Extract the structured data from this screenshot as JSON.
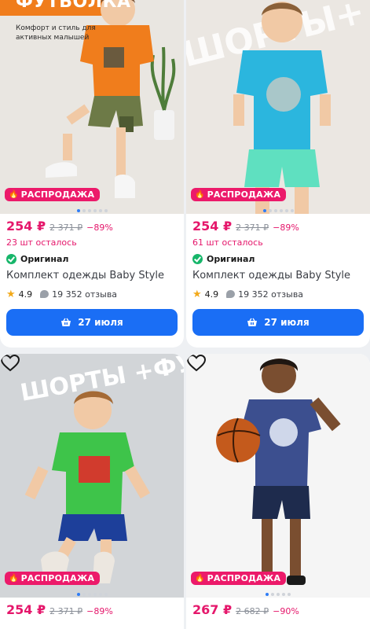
{
  "cards": [
    {
      "promo_title": "ФУТБОЛКА",
      "promo_sub": "Комфорт и стиль для активных малышей",
      "sale_badge": "РАСПРОДАЖА",
      "price": "254 ₽",
      "old_price": "2 371 ₽",
      "discount": "−89%",
      "stock": "23 шт осталось",
      "original": "Оригинал",
      "name": "Комплект одежды Baby Style",
      "rating": "4.9",
      "reviews": "19 352 отзыва",
      "delivery": "27 июля",
      "colors": {
        "bg": "#e9e6e1",
        "shirt": "#f07d1c",
        "shorts": "#6d7a47"
      }
    },
    {
      "promo_title": "ШОРТЫ+ ФУТБОЛКА",
      "sale_badge": "РАСПРОДАЖА",
      "price": "254 ₽",
      "old_price": "2 371 ₽",
      "discount": "−89%",
      "stock": "61 шт осталось",
      "original": "Оригинал",
      "name": "Комплект одежды Baby Style",
      "rating": "4.9",
      "reviews": "19 352 отзыва",
      "delivery": "27 июля",
      "colors": {
        "bg": "#ebe7e2",
        "shirt": "#2bb6de",
        "shorts": "#5fe0c0"
      }
    },
    {
      "promo_title": "ШОРТЫ +ФУТБОЛКА",
      "sale_badge": "РАСПРОДАЖА",
      "price": "254 ₽",
      "old_price": "2 371 ₽",
      "discount": "−89%",
      "colors": {
        "bg": "#d2d5d8",
        "shirt": "#3ec44a",
        "shorts": "#1d3f9a"
      }
    },
    {
      "sale_badge": "РАСПРОДАЖА",
      "price": "267 ₽",
      "old_price": "2 682 ₽",
      "discount": "−90%",
      "colors": {
        "bg": "#f5f5f5",
        "shirt": "#3c4f8f",
        "shorts": "#1e2b4d"
      }
    }
  ],
  "icons": {
    "favorite": "heart-outline-icon",
    "sale": "fire-icon",
    "verified": "check-circle-icon",
    "star": "star-icon",
    "reviews": "chat-bubble-icon",
    "delivery": "basket-icon"
  }
}
